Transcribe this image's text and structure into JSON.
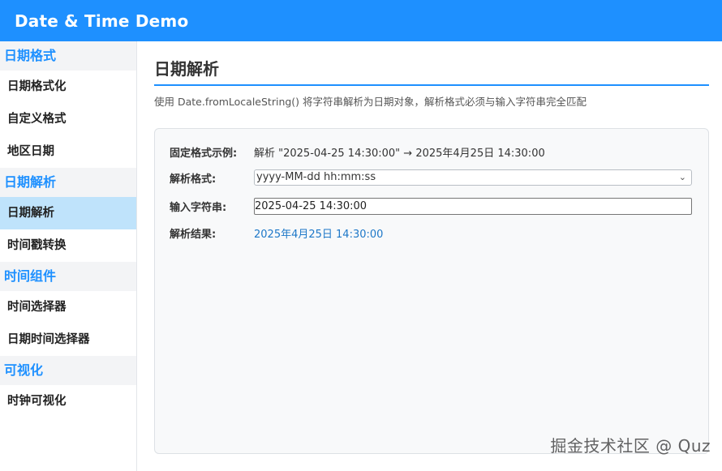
{
  "app": {
    "title": "Date & Time Demo"
  },
  "sidebar": {
    "groups": [
      {
        "title": "日期格式",
        "items": [
          "日期格式化",
          "自定义格式",
          "地区日期"
        ]
      },
      {
        "title": "日期解析",
        "items": [
          "日期解析",
          "时间戳转换"
        ]
      },
      {
        "title": "时间组件",
        "items": [
          "时间选择器",
          "日期时间选择器"
        ]
      },
      {
        "title": "可视化",
        "items": [
          "时钟可视化"
        ]
      }
    ],
    "active_item": "日期解析"
  },
  "main": {
    "title": "日期解析",
    "description": "使用 Date.fromLocaleString() 将字符串解析为日期对象，解析格式必须与输入字符串完全匹配",
    "card": {
      "example_label": "固定格式示例:",
      "example_value": "解析 \"2025-04-25 14:30:00\" → 2025年4月25日 14:30:00",
      "format_label": "解析格式:",
      "format_selected": "yyyy-MM-dd hh:mm:ss",
      "input_label": "输入字符串:",
      "input_value": "2025-04-25 14:30:00",
      "result_label": "解析结果:",
      "result_value": "2025年4月25日 14:30:00"
    }
  },
  "watermark": "掘金技术社区 @ Quz",
  "colors": {
    "brand": "#1e90ff",
    "active_bg": "#bfe3fb",
    "result_text": "#1e78c8"
  }
}
